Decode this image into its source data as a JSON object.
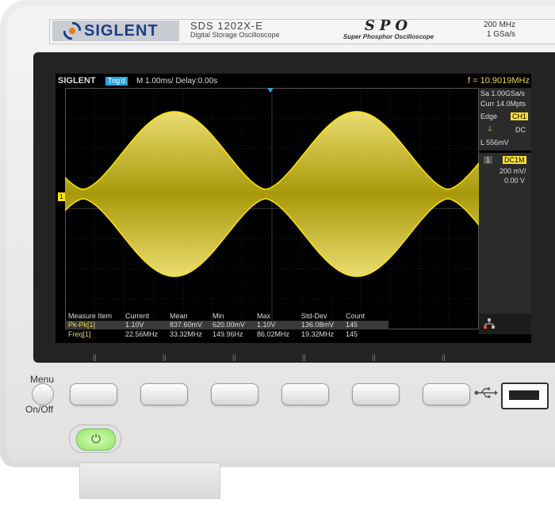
{
  "panel": {
    "brand": "SIGLENT",
    "model": "SDS 1202X-E",
    "model_subtitle": "Digital Storage Oscilloscope",
    "spo_logo": "SPO",
    "spo_subtitle": "Super Phosphor Oscilloscope",
    "bandwidth": "200 MHz",
    "sample_rate": "1 GSa/s"
  },
  "screen": {
    "brand": "SIGLENT",
    "trigger_status": "Trig'd",
    "timebase": "M 1.00ms/ Delay:0.00s",
    "frequency": "f = 10.9019MHz",
    "right_panel": {
      "sa": "Sa 1.00GSa/s",
      "curr": "Curr 14.0Mpts",
      "trigger_type": "Edge",
      "trigger_source": "CH1",
      "coupling": "DC",
      "level": "L  556mV",
      "channel_num": "1",
      "channel_coupling": "DC1M",
      "volts_div": "200 mV/",
      "offset": "0.00 V"
    },
    "channel_marker": "1",
    "waveform_color": "#ffe600",
    "measurements": {
      "headers": [
        "Measure Item",
        "Current",
        "Mean",
        "Min",
        "Max",
        "Std-Dev",
        "Count"
      ],
      "rows": [
        [
          "Pk-Pk[1]",
          "1.10V",
          "837.60mV",
          "620.00mV",
          "1.10V",
          "136.08mV",
          "145"
        ],
        [
          "Freq[1]",
          "22.56MHz",
          "33.32MHz",
          "149.96Hz",
          "86.02MHz",
          "19.32MHz",
          "145"
        ]
      ]
    }
  },
  "controls": {
    "menu_label": "Menu",
    "onoff_label": "On/Off",
    "softkey_count": 6,
    "power_icon": "power-icon",
    "usb_icon": "usb-icon"
  }
}
